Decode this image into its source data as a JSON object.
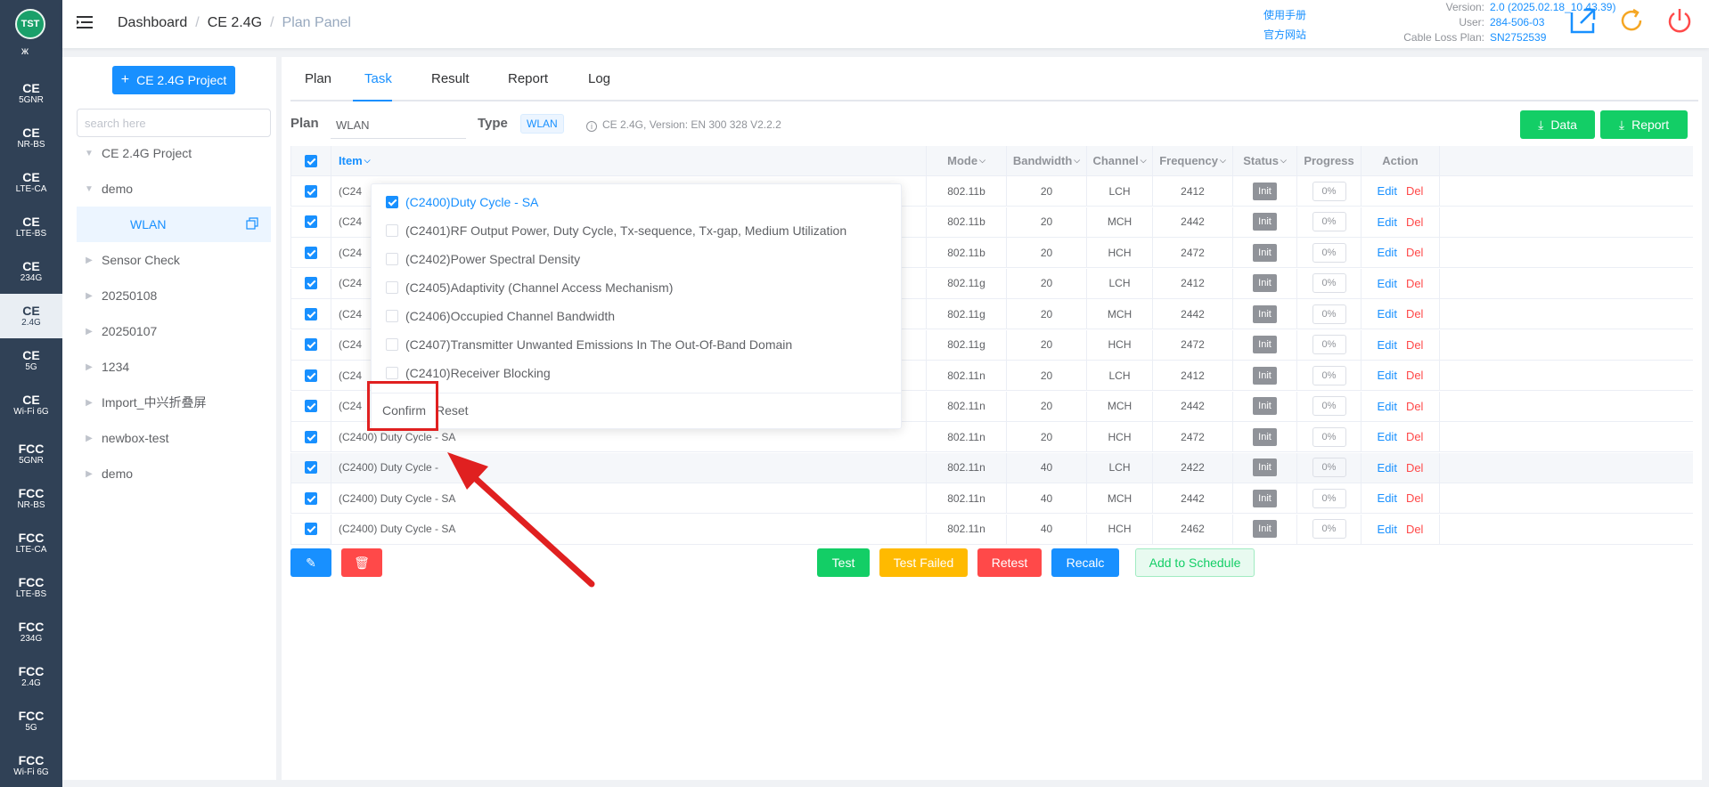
{
  "rail": {
    "logo": "TST",
    "logo_sub": "ж",
    "items": [
      {
        "r1": "CE",
        "r2": "5GNR"
      },
      {
        "r1": "CE",
        "r2": "NR-BS"
      },
      {
        "r1": "CE",
        "r2": "LTE-CA"
      },
      {
        "r1": "CE",
        "r2": "LTE-BS"
      },
      {
        "r1": "CE",
        "r2": "234G"
      },
      {
        "r1": "CE",
        "r2": "2.4G"
      },
      {
        "r1": "CE",
        "r2": "5G"
      },
      {
        "r1": "CE",
        "r2": "Wi-Fi 6G"
      },
      {
        "r1": "FCC",
        "r2": "5GNR"
      },
      {
        "r1": "FCC",
        "r2": "NR-BS"
      },
      {
        "r1": "FCC",
        "r2": "LTE-CA"
      },
      {
        "r1": "FCC",
        "r2": "LTE-BS"
      },
      {
        "r1": "FCC",
        "r2": "234G"
      },
      {
        "r1": "FCC",
        "r2": "2.4G"
      },
      {
        "r1": "FCC",
        "r2": "5G"
      },
      {
        "r1": "FCC",
        "r2": "Wi-Fi 6G"
      }
    ]
  },
  "header": {
    "breadcrumb": [
      "Dashboard",
      "CE 2.4G",
      "Plan Panel"
    ],
    "links": [
      "使用手册",
      "官方网站"
    ],
    "version_label": "Version:",
    "version": "2.0 (2025.02.18_10.43.39)",
    "user_label": "User:",
    "user": "284-506-03",
    "cable_label": "Cable Loss Plan:",
    "cable": "SN2752539",
    "colors": {
      "accent": "#1890ff",
      "refresh": "#f5a623",
      "power": "#ff4949"
    }
  },
  "tree": {
    "new_project_label": "CE 2.4G Project",
    "search_placeholder": "search here",
    "nodes": [
      {
        "label": "CE 2.4G Project",
        "arrow": "▼"
      },
      {
        "label": "demo",
        "arrow": "▼"
      },
      {
        "label": "WLAN",
        "arrow": ""
      },
      {
        "label": "Sensor Check",
        "arrow": "▶"
      },
      {
        "label": "20250108",
        "arrow": "▶"
      },
      {
        "label": "20250107",
        "arrow": "▶"
      },
      {
        "label": "1234",
        "arrow": "▶"
      },
      {
        "label": "Import_中兴折叠屏",
        "arrow": "▶"
      },
      {
        "label": "newbox-test",
        "arrow": "▶"
      },
      {
        "label": "demo",
        "arrow": "▶"
      }
    ]
  },
  "tabs": [
    "Plan",
    "Task",
    "Result",
    "Report",
    "Log"
  ],
  "plan": {
    "plan_label": "Plan",
    "plan_value": "WLAN",
    "type_label": "Type",
    "type_value": "WLAN",
    "info": "CE 2.4G, Version: EN 300 328 V2.2.2",
    "data_btn": "Data",
    "report_btn": "Report"
  },
  "table": {
    "headers": [
      "Item",
      "Mode",
      "Bandwidth",
      "Channel",
      "Frequency",
      "Status",
      "Progress",
      "Action"
    ],
    "edit_label": "Edit",
    "del_label": "Del",
    "rows": [
      {
        "item": "(C24",
        "mode": "802.11b",
        "bw": "20",
        "ch": "LCH",
        "freq": "2412",
        "status": "Init",
        "progress": "0%"
      },
      {
        "item": "(C24",
        "mode": "802.11b",
        "bw": "20",
        "ch": "MCH",
        "freq": "2442",
        "status": "Init",
        "progress": "0%"
      },
      {
        "item": "(C24",
        "mode": "802.11b",
        "bw": "20",
        "ch": "HCH",
        "freq": "2472",
        "status": "Init",
        "progress": "0%"
      },
      {
        "item": "(C24",
        "mode": "802.11g",
        "bw": "20",
        "ch": "LCH",
        "freq": "2412",
        "status": "Init",
        "progress": "0%"
      },
      {
        "item": "(C24",
        "mode": "802.11g",
        "bw": "20",
        "ch": "MCH",
        "freq": "2442",
        "status": "Init",
        "progress": "0%"
      },
      {
        "item": "(C24",
        "mode": "802.11g",
        "bw": "20",
        "ch": "HCH",
        "freq": "2472",
        "status": "Init",
        "progress": "0%"
      },
      {
        "item": "(C24",
        "mode": "802.11n",
        "bw": "20",
        "ch": "LCH",
        "freq": "2412",
        "status": "Init",
        "progress": "0%"
      },
      {
        "item": "(C24",
        "mode": "802.11n",
        "bw": "20",
        "ch": "MCH",
        "freq": "2442",
        "status": "Init",
        "progress": "0%"
      },
      {
        "item": "(C2400) Duty Cycle - SA",
        "mode": "802.11n",
        "bw": "20",
        "ch": "HCH",
        "freq": "2472",
        "status": "Init",
        "progress": "0%"
      },
      {
        "item": "(C2400) Duty Cycle -",
        "mode": "802.11n",
        "bw": "40",
        "ch": "LCH",
        "freq": "2422",
        "status": "Init",
        "progress": "0%"
      },
      {
        "item": "(C2400) Duty Cycle - SA",
        "mode": "802.11n",
        "bw": "40",
        "ch": "MCH",
        "freq": "2442",
        "status": "Init",
        "progress": "0%"
      },
      {
        "item": "(C2400) Duty Cycle - SA",
        "mode": "802.11n",
        "bw": "40",
        "ch": "HCH",
        "freq": "2462",
        "status": "Init",
        "progress": "0%"
      }
    ]
  },
  "filter": {
    "options": [
      {
        "label": "(C2400)Duty Cycle - SA",
        "checked": true
      },
      {
        "label": "(C2401)RF Output Power, Duty Cycle, Tx-sequence, Tx-gap, Medium Utilization",
        "checked": false
      },
      {
        "label": "(C2402)Power Spectral Density",
        "checked": false
      },
      {
        "label": "(C2405)Adaptivity (Channel Access Mechanism)",
        "checked": false
      },
      {
        "label": "(C2406)Occupied Channel Bandwidth",
        "checked": false
      },
      {
        "label": "(C2407)Transmitter Unwanted Emissions In The Out-Of-Band Domain",
        "checked": false
      },
      {
        "label": "(C2410)Receiver Blocking",
        "checked": false
      }
    ],
    "confirm": "Confirm",
    "reset": "Reset"
  },
  "actions": {
    "test": "Test",
    "test_failed": "Test Failed",
    "retest": "Retest",
    "recalc": "Recalc",
    "schedule": "Add to Schedule"
  }
}
